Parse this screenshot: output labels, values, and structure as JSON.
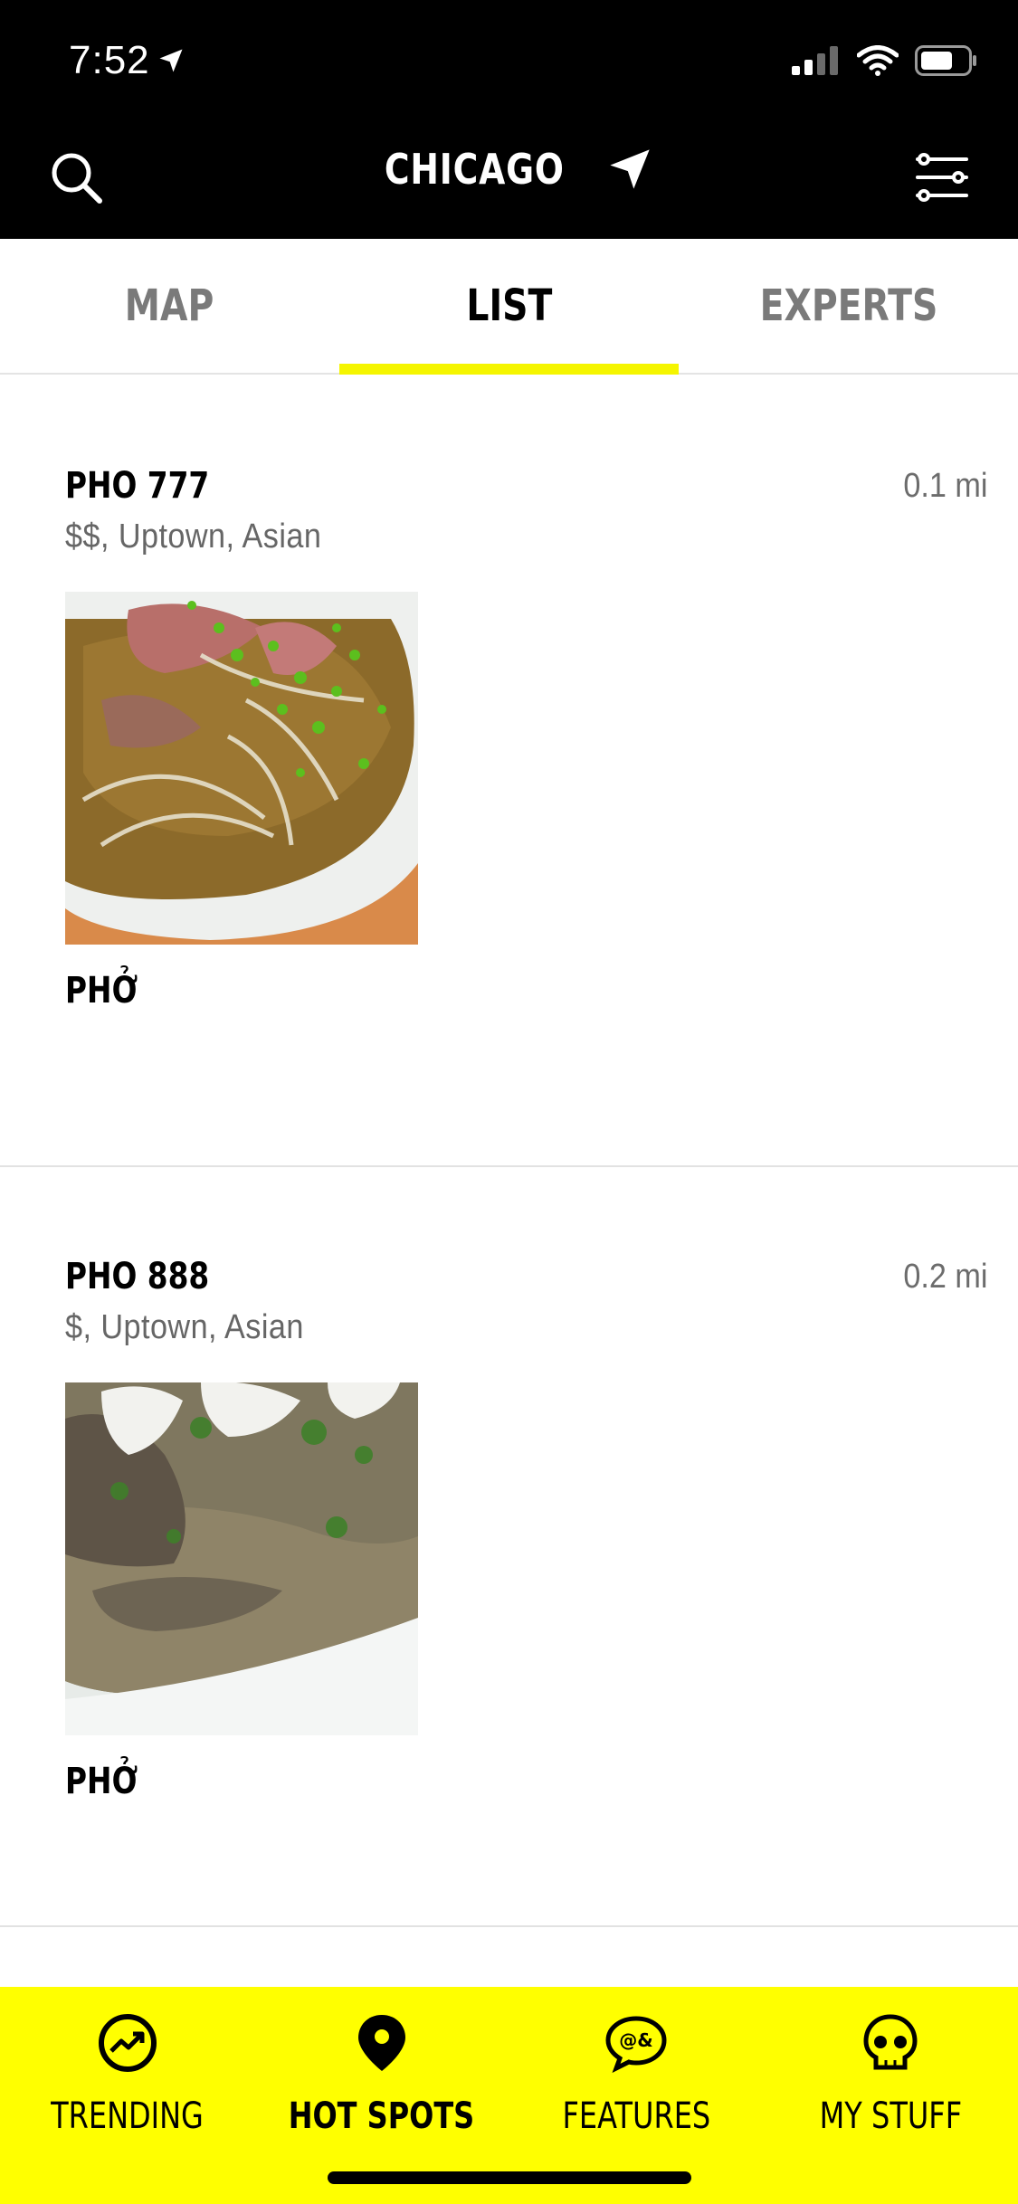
{
  "status_bar": {
    "time": "7:52"
  },
  "header": {
    "city": "CHICAGO"
  },
  "tabs": [
    {
      "label": "MAP"
    },
    {
      "label": "LIST"
    },
    {
      "label": "EXPERTS"
    }
  ],
  "active_tab": "LIST",
  "places": [
    {
      "name": "PHO 777",
      "meta": "$$, Uptown, Asian",
      "distance": "0.1 mi",
      "dish": "PHỞ"
    },
    {
      "name": "PHO 888",
      "meta": "$, Uptown, Asian",
      "distance": "0.2 mi",
      "dish": "PHỞ"
    }
  ],
  "bottom_nav": [
    {
      "label": "TRENDING",
      "icon": "trending-icon"
    },
    {
      "label": "HOT SPOTS",
      "icon": "map-pin-icon"
    },
    {
      "label": "FEATURES",
      "icon": "chat-bubbles-icon"
    },
    {
      "label": "MY STUFF",
      "icon": "skull-icon"
    }
  ],
  "active_nav": "HOT SPOTS",
  "colors": {
    "accent": "#ffff00",
    "header_bg": "#000000",
    "muted_text": "#7a7a7a"
  }
}
